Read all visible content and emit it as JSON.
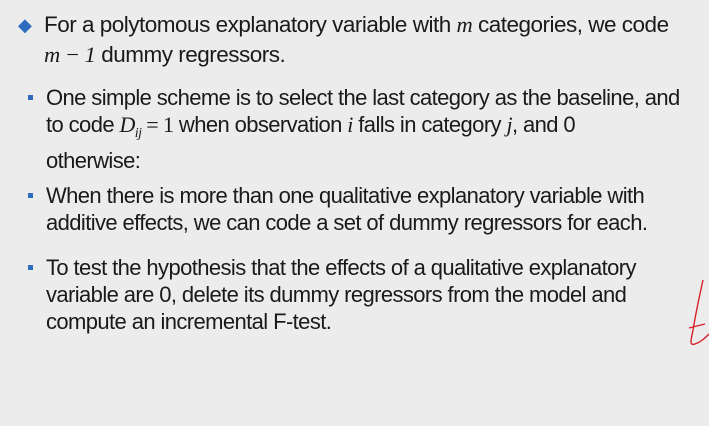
{
  "bullet_main": {
    "l1_pre": "For a polytomous explanatory variable with ",
    "m": "m",
    "l1_post": " categories, we code",
    "l2_math": "m − 1",
    "l2_post": " dummy  regressors."
  },
  "sub_bullets": [
    {
      "l1": "One simple scheme is to select the last category as the baseline, and",
      "l2_pre": "to code ",
      "D": "D",
      "ij": "ij",
      "eq": " = 1",
      "l2_mid": " when observation ",
      "i": "i",
      "l2_mid2": " falls in category ",
      "j": "j",
      "l2_post": ", and 0",
      "l3": "otherwise:"
    },
    {
      "l1": "When there is more than one qualitative explanatory variable with",
      "l2": "additive effects, we can code a set of dummy regressors for each."
    },
    {
      "l1": "To test the hypothesis that the effects of a qualitative explanatory",
      "l2": "variable are 0, delete its dummy regressors from the model and",
      "l3": "compute an incremental F-test."
    }
  ],
  "colors": {
    "bullet": "#2f6bbf",
    "text": "#1a1a1a",
    "background": "#ececec",
    "pen": "#d8202a"
  }
}
